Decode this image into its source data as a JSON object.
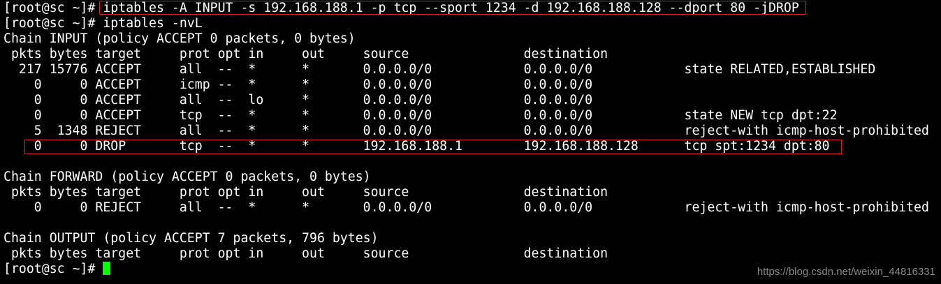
{
  "terminal": {
    "prompt": "[root@sc ~]# ",
    "command1": "iptables -A INPUT -s 192.168.188.1 -p tcp --sport 1234 -d 192.168.188.128 --dport 80 -jDROP",
    "command2": "iptables -nvL",
    "input_chain": {
      "title": "Chain INPUT (policy ACCEPT 0 packets, 0 bytes)",
      "header": " pkts bytes target     prot opt in     out     source               destination",
      "rows": [
        "  217 15776 ACCEPT     all  --  *      *       0.0.0.0/0            0.0.0.0/0            state RELATED,ESTABLISHED",
        "    0     0 ACCEPT     icmp --  *      *       0.0.0.0/0            0.0.0.0/0",
        "    0     0 ACCEPT     all  --  lo     *       0.0.0.0/0            0.0.0.0/0",
        "    0     0 ACCEPT     tcp  --  *      *       0.0.0.0/0            0.0.0.0/0            state NEW tcp dpt:22",
        "    5  1348 REJECT     all  --  *      *       0.0.0.0/0            0.0.0.0/0            reject-with icmp-host-prohibited",
        "    0     0 DROP       tcp  --  *      *       192.168.188.1        192.168.188.128      tcp spt:1234 dpt:80"
      ]
    },
    "forward_chain": {
      "title": "Chain FORWARD (policy ACCEPT 0 packets, 0 bytes)",
      "header": " pkts bytes target     prot opt in     out     source               destination",
      "rows": [
        "    0     0 REJECT     all  --  *      *       0.0.0.0/0            0.0.0.0/0            reject-with icmp-host-prohibited"
      ]
    },
    "output_chain": {
      "title": "Chain OUTPUT (policy ACCEPT 7 packets, 796 bytes)",
      "header": " pkts bytes target     prot opt in     out     source               destination"
    }
  },
  "watermark": "https://blog.csdn.net/weixin_44816331",
  "colors": {
    "background": "#000000",
    "text": "#ffffff",
    "highlight_box": "#e02020",
    "cursor": "#00ff00"
  }
}
